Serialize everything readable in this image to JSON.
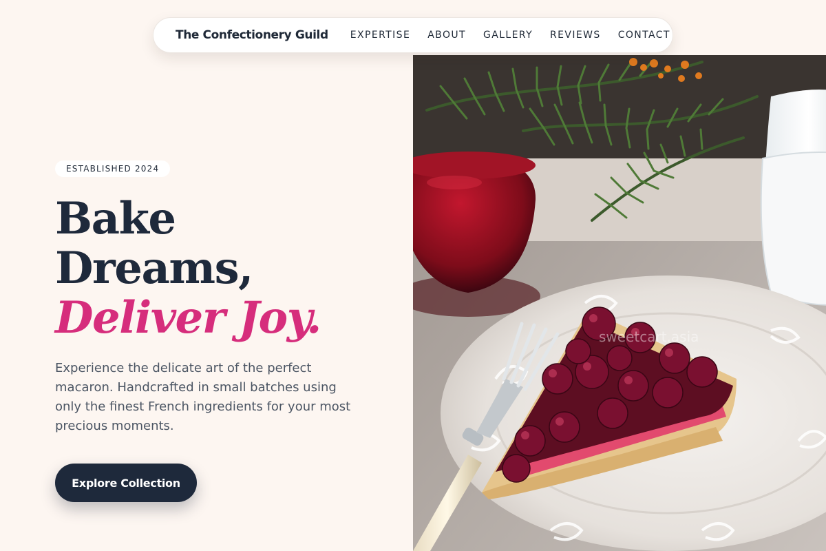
{
  "nav": {
    "brand": "The Confectionery Guild",
    "links": [
      "EXPERTISE",
      "ABOUT",
      "GALLERY",
      "REVIEWS",
      "CONTACT"
    ]
  },
  "hero": {
    "badge": "ESTABLISHED 2024",
    "headline_line1": "Bake",
    "headline_line2": "Dreams,",
    "headline_accent": "Deliver Joy.",
    "description": "Experience the delicate art of the perfect macaron. Handcrafted in small batches using only the finest French ingredients for your most precious moments.",
    "cta_label": "Explore Collection"
  },
  "image": {
    "watermark": "sweetcart.asia"
  },
  "colors": {
    "background": "#fdf6f1",
    "heading": "#1e293b",
    "accent": "#d62d7c",
    "button": "#1e293b"
  }
}
